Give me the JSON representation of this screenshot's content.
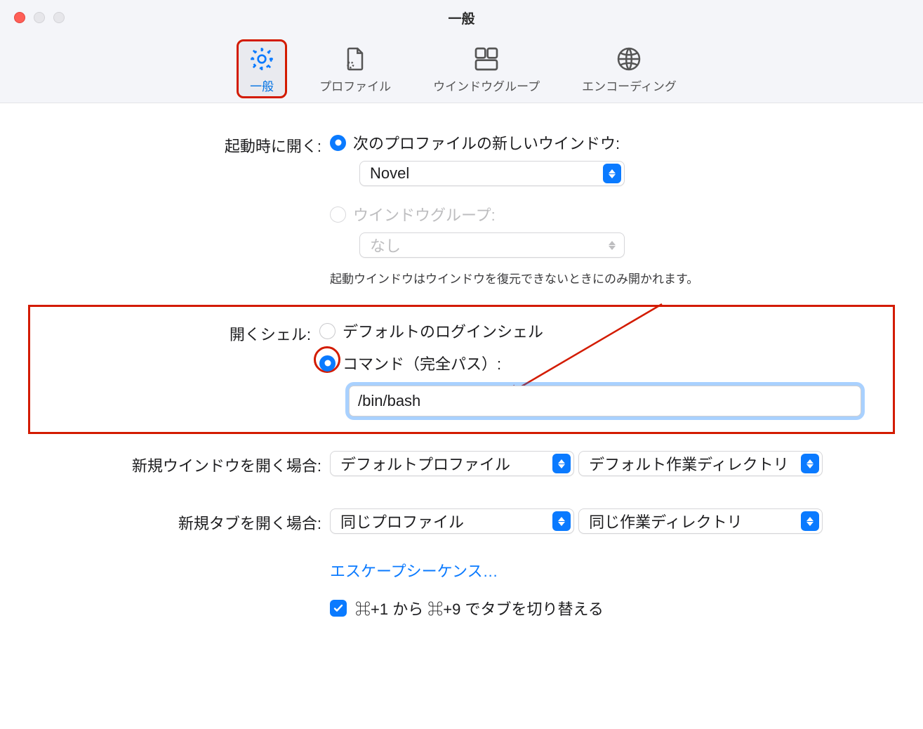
{
  "window": {
    "title": "一般"
  },
  "toolbar": {
    "general": "一般",
    "profiles": "プロファイル",
    "groups": "ウインドウグループ",
    "encodings": "エンコーディング"
  },
  "startup": {
    "label": "起動時に開く:",
    "radio_profile": "次のプロファイルの新しいウインドウ:",
    "profile_select": "Novel",
    "radio_group": "ウインドウグループ:",
    "group_select": "なし",
    "helper": "起動ウインドウはウインドウを復元できないときにのみ開かれます。"
  },
  "shell": {
    "label": "開くシェル:",
    "radio_default": "デフォルトのログインシェル",
    "radio_command": "コマンド（完全パス）:",
    "command_value": "/bin/bash"
  },
  "new_window": {
    "label": "新規ウインドウを開く場合:",
    "profile_select": "デフォルトプロファイル",
    "dir_select": "デフォルト作業ディレクトリ"
  },
  "new_tab": {
    "label": "新規タブを開く場合:",
    "profile_select": "同じプロファイル",
    "dir_select": "同じ作業ディレクトリ"
  },
  "escape_link": "エスケープシーケンス…",
  "tab_switch_checkbox": "⌘+1 から ⌘+9 でタブを切り替える"
}
